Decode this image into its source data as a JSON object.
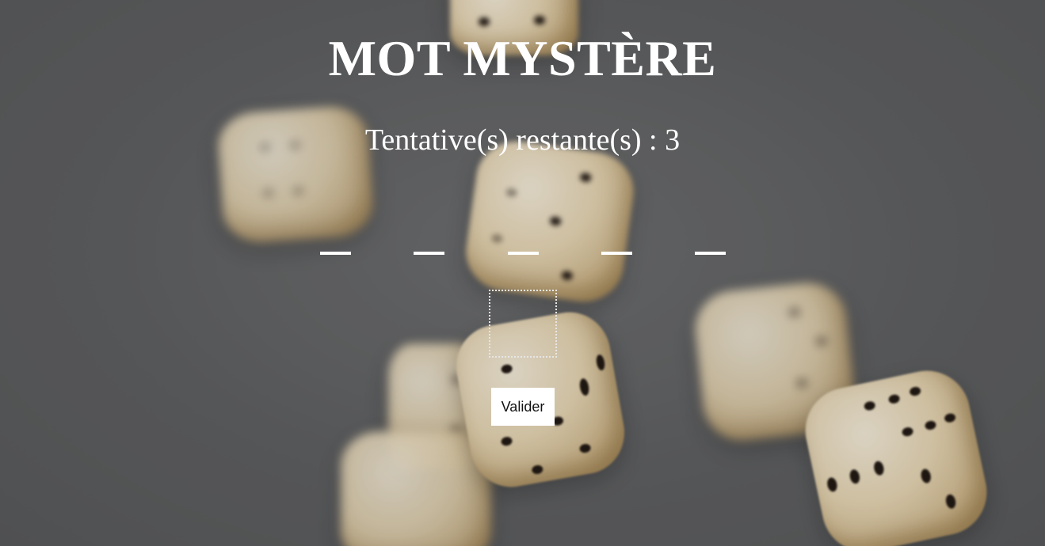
{
  "game": {
    "title": "MOT MYSTÈRE",
    "attempts_text": "Tentative(s) restante(s) : 3",
    "word_slots": [
      "",
      "",
      "",
      "",
      ""
    ],
    "letter_input_value": "",
    "validate_label": "Valider"
  },
  "background": {
    "subject": "falling-dice",
    "overlay_color": "#5f6062"
  }
}
